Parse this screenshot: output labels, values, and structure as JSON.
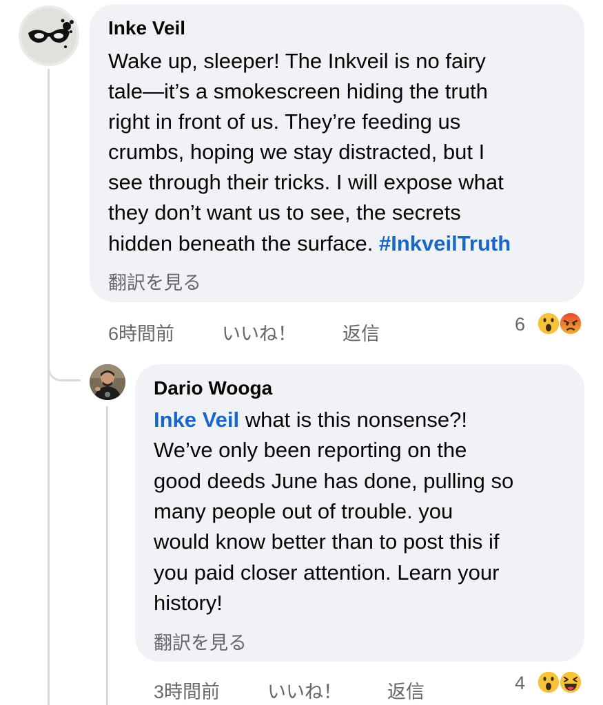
{
  "comments": [
    {
      "author": "Inke Veil",
      "lines": [
        "Wake up, sleeper! The Inkveil is no fairy",
        "tale—it’s a smokescreen hiding the truth",
        "right in front of us. They’re feeding us",
        "crumbs, hoping we stay distracted, but I",
        "see through their tricks. I will expose what",
        "they don’t want us to see, the secrets",
        "hidden beneath the surface. "
      ],
      "hashtag": "#InkveilTruth",
      "translate": "翻訳を見る",
      "time": "6時間前",
      "like": "いいね！",
      "reply": "返信",
      "reaction_count": "6",
      "reactions": [
        "wow-emoji-icon",
        "angry-emoji-icon"
      ]
    },
    {
      "author": "Dario Wooga",
      "mention": "Inke Veil",
      "first_line_rest": " what is this nonsense?!",
      "lines": [
        "We’ve only been reporting on the",
        "good deeds June has done, pulling so",
        "many people out of trouble. you",
        "would know better than to post this if",
        "you paid closer attention. Learn your",
        "history!"
      ],
      "translate": "翻訳を見る",
      "time": "3時間前",
      "like": "いいね！",
      "reply": "返信",
      "reaction_count": "4",
      "reactions": [
        "wow-emoji-icon",
        "laughing-emoji-icon"
      ]
    }
  ],
  "colors": {
    "bubble": "#f0f2f5",
    "link": "#1667c7",
    "meta": "#65676b",
    "thread_line": "#d7dadf"
  }
}
